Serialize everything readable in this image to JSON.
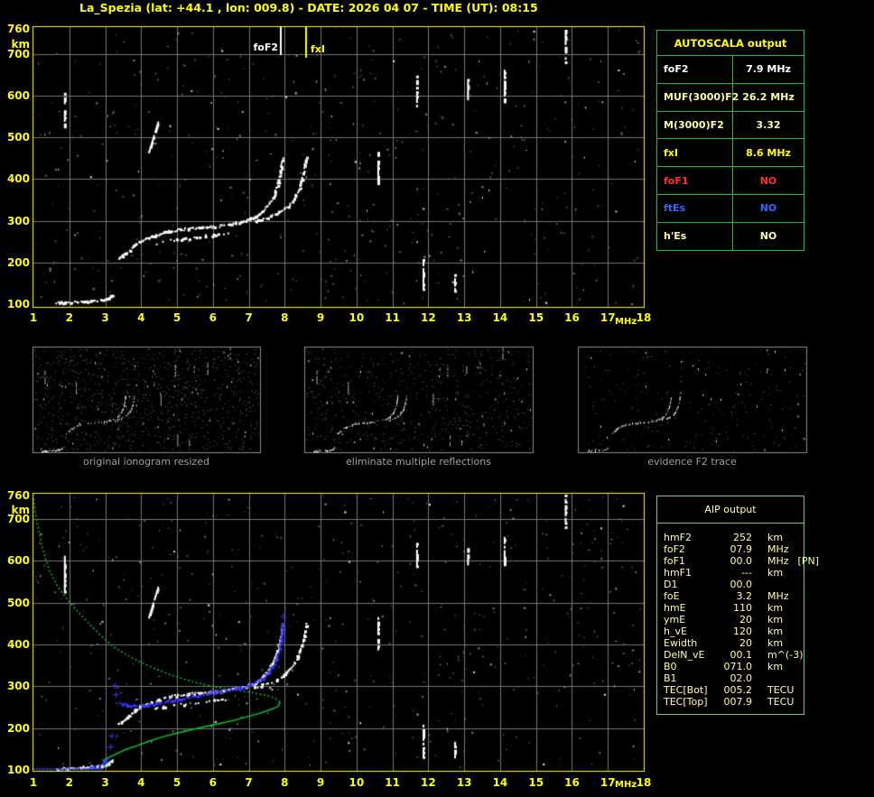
{
  "title": "La_Spezia (lat: +44.1 , lon: 009.8) - DATE:  2026 04 07  - TIME (UT):  08:15",
  "colors": {
    "accent_yellow": "#ffff00",
    "cream": "#ffff9e",
    "white": "#ffffff",
    "red": "#ff3232",
    "blue": "#3366ff",
    "profile_green": "#00cc33",
    "restored_blue": "#3333ff",
    "grid_gray": "#767676",
    "frame_yellow": "#ffff00",
    "autoscala_border": "#00c750",
    "aip_border": "#6fcf6f",
    "panel_border": "#8c8c8c",
    "caption_gray": "#a0a0a0"
  },
  "autoscala_table": {
    "header": "AUTOSCALA output",
    "rows": [
      {
        "label": "foF2",
        "value": "7.9 MHz",
        "color": "#ffffff"
      },
      {
        "label": "MUF(3000)F2",
        "value": "26.2 MHz",
        "color": "#ffff9e"
      },
      {
        "label": "M(3000)F2",
        "value": "3.32",
        "color": "#ffff9e"
      },
      {
        "label": "fxI",
        "value": "8.6 MHz",
        "color": "#ffff00"
      },
      {
        "label": "foF1",
        "value": "NO",
        "color": "#ff3232"
      },
      {
        "label": "ftEs",
        "value": "NO",
        "color": "#3366ff"
      },
      {
        "label": "h'Es",
        "value": "NO",
        "color": "#ffff9e"
      }
    ]
  },
  "aip_table": {
    "header": "AIP output",
    "rows": [
      {
        "label": "hmF2",
        "value": "252",
        "unit": "km",
        "note": ""
      },
      {
        "label": "foF2",
        "value": "07.9",
        "unit": "MHz",
        "note": ""
      },
      {
        "label": "foF1",
        "value": "00.0",
        "unit": "MHz",
        "note": "[PN]"
      },
      {
        "label": "hmF1",
        "value": "---",
        "unit": "km",
        "note": ""
      },
      {
        "label": "D1",
        "value": "00.0",
        "unit": "",
        "note": ""
      },
      {
        "label": "foE",
        "value": "3.2",
        "unit": "MHz",
        "note": ""
      },
      {
        "label": "hmE",
        "value": "110",
        "unit": "km",
        "note": ""
      },
      {
        "label": "ymE",
        "value": "20",
        "unit": "km",
        "note": ""
      },
      {
        "label": "h_vE",
        "value": "120",
        "unit": "km",
        "note": ""
      },
      {
        "label": "Ewidth",
        "value": "20",
        "unit": "km",
        "note": ""
      },
      {
        "label": "DelN_vE",
        "value": "00.1",
        "unit": "m^(-3)",
        "note": ""
      },
      {
        "label": "B0",
        "value": "071.0",
        "unit": "km",
        "note": ""
      },
      {
        "label": "B1",
        "value": "02.0",
        "unit": "",
        "note": ""
      },
      {
        "label": "TEC[Bot]",
        "value": "005.2",
        "unit": "TECU",
        "note": ""
      },
      {
        "label": "TEC[Top]",
        "value": "007.9",
        "unit": "TECU",
        "note": ""
      }
    ]
  },
  "panels": [
    {
      "caption": "original ionogram resized"
    },
    {
      "caption": "eliminate multiple reflections"
    },
    {
      "caption": "evidence F2 trace"
    }
  ],
  "chart_data": [
    {
      "type": "scatter",
      "name": "autoscaled ionogram",
      "xlabel": "MHz",
      "ylabel": "km",
      "xlim": [
        1,
        18
      ],
      "ylim": [
        100,
        760
      ],
      "xticks": [
        1,
        2,
        3,
        4,
        5,
        6,
        7,
        8,
        9,
        10,
        11,
        12,
        13,
        14,
        15,
        16,
        17,
        18
      ],
      "yticks": [
        760,
        700,
        600,
        500,
        400,
        300,
        200,
        100
      ],
      "grid": true,
      "markers": [
        {
          "label": "foF2",
          "freq": 7.9,
          "color": "#ffffff"
        },
        {
          "label": "fxI",
          "freq": 8.6,
          "color": "#ffff00"
        }
      ],
      "series": [
        {
          "name": "E-layer echo",
          "color": "#ffffff",
          "points": [
            [
              1.62,
              104
            ],
            [
              1.75,
              106
            ],
            [
              1.9,
              105
            ],
            [
              2.05,
              107
            ],
            [
              2.2,
              106
            ],
            [
              2.35,
              108
            ],
            [
              2.5,
              107
            ],
            [
              2.62,
              109
            ],
            [
              2.75,
              111
            ],
            [
              2.88,
              112
            ],
            [
              3.0,
              114
            ],
            [
              3.1,
              118
            ],
            [
              3.18,
              125
            ]
          ]
        },
        {
          "name": "F2 O-mode trace",
          "color": "#ffffff",
          "points": [
            [
              3.35,
              211
            ],
            [
              3.45,
              216
            ],
            [
              3.55,
              222
            ],
            [
              3.68,
              232
            ],
            [
              3.82,
              244
            ],
            [
              3.95,
              252
            ],
            [
              4.1,
              258
            ],
            [
              4.3,
              264
            ],
            [
              4.5,
              270
            ],
            [
              4.75,
              276
            ],
            [
              5.0,
              280
            ],
            [
              5.3,
              283
            ],
            [
              5.6,
              285
            ],
            [
              5.9,
              287
            ],
            [
              6.2,
              290
            ],
            [
              6.5,
              294
            ],
            [
              6.8,
              299
            ],
            [
              7.0,
              305
            ],
            [
              7.2,
              313
            ],
            [
              7.35,
              323
            ],
            [
              7.5,
              336
            ],
            [
              7.62,
              352
            ],
            [
              7.72,
              370
            ],
            [
              7.8,
              392
            ],
            [
              7.86,
              416
            ],
            [
              7.9,
              438
            ],
            [
              7.92,
              452
            ]
          ]
        },
        {
          "name": "F2 lower echo",
          "color": "#ffffff",
          "points": [
            [
              4.35,
              247
            ],
            [
              4.6,
              252
            ],
            [
              4.9,
              256
            ],
            [
              5.2,
              259
            ],
            [
              5.5,
              262
            ],
            [
              5.8,
              265
            ],
            [
              6.1,
              268
            ],
            [
              6.4,
              271
            ]
          ]
        },
        {
          "name": "F2 X-mode trace",
          "color": "#ffffff",
          "points": [
            [
              7.15,
              299
            ],
            [
              7.35,
              304
            ],
            [
              7.55,
              310
            ],
            [
              7.75,
              318
            ],
            [
              7.95,
              328
            ],
            [
              8.1,
              340
            ],
            [
              8.25,
              356
            ],
            [
              8.37,
              376
            ],
            [
              8.46,
              398
            ],
            [
              8.52,
              420
            ],
            [
              8.56,
              440
            ],
            [
              8.58,
              452
            ]
          ]
        }
      ],
      "interference_streaks": [
        [
          1.85,
          528,
          1.85,
          612
        ],
        [
          4.2,
          468,
          4.45,
          538
        ],
        [
          10.58,
          392,
          10.58,
          465
        ],
        [
          11.66,
          578,
          11.66,
          648
        ],
        [
          11.84,
          133,
          11.84,
          208
        ],
        [
          12.72,
          134,
          12.72,
          172
        ],
        [
          13.08,
          595,
          13.08,
          640
        ],
        [
          14.1,
          588,
          14.1,
          662
        ],
        [
          15.8,
          682,
          15.8,
          758
        ]
      ]
    },
    {
      "type": "scatter",
      "name": "ionogram with AIP inversion",
      "xlabel": "MHz",
      "ylabel": "km",
      "xlim": [
        1,
        18
      ],
      "ylim": [
        100,
        760
      ],
      "xticks": [
        1,
        2,
        3,
        4,
        5,
        6,
        7,
        8,
        9,
        10,
        11,
        12,
        13,
        14,
        15,
        16,
        17,
        18
      ],
      "yticks": [
        760,
        700,
        600,
        500,
        400,
        300,
        200,
        100
      ],
      "grid": true,
      "markers": [],
      "profile": {
        "name": "electron density profile",
        "color": "#00cc33",
        "topside": [
          [
            1.0,
            748
          ],
          [
            1.1,
            690
          ],
          [
            1.25,
            630
          ],
          [
            1.45,
            575
          ],
          [
            1.7,
            535
          ],
          [
            2.0,
            502
          ],
          [
            2.3,
            472
          ],
          [
            2.62,
            443
          ],
          [
            2.95,
            415
          ],
          [
            3.3,
            390
          ],
          [
            3.8,
            365
          ],
          [
            4.3,
            345
          ],
          [
            4.8,
            328
          ],
          [
            5.3,
            314
          ],
          [
            5.8,
            303
          ],
          [
            6.3,
            295
          ],
          [
            6.8,
            289
          ],
          [
            7.2,
            283
          ],
          [
            7.55,
            277
          ],
          [
            7.75,
            270
          ],
          [
            7.87,
            262
          ]
        ],
        "bottomside": [
          [
            7.87,
            262
          ],
          [
            7.82,
            252
          ],
          [
            7.6,
            244
          ],
          [
            7.3,
            235
          ],
          [
            7.0,
            228
          ],
          [
            6.6,
            219
          ],
          [
            6.2,
            211
          ],
          [
            5.8,
            204
          ],
          [
            5.4,
            196
          ],
          [
            5.0,
            188
          ],
          [
            4.6,
            179
          ],
          [
            4.2,
            168
          ],
          [
            3.85,
            157
          ],
          [
            3.55,
            148
          ],
          [
            3.3,
            138
          ],
          [
            3.1,
            130
          ],
          [
            2.95,
            123
          ],
          [
            2.97,
            118
          ],
          [
            3.08,
            115
          ],
          [
            3.1,
            110
          ],
          [
            2.98,
            106
          ],
          [
            2.8,
            104
          ],
          [
            2.55,
            103
          ],
          [
            2.35,
            103
          ]
        ]
      },
      "restored_trace": {
        "name": "restored trace",
        "color": "#3333ff",
        "points": [
          [
            3.32,
            263
          ],
          [
            3.45,
            259
          ],
          [
            3.6,
            257
          ],
          [
            3.8,
            256
          ],
          [
            4.0,
            256
          ],
          [
            4.2,
            258
          ],
          [
            4.45,
            261
          ],
          [
            4.7,
            265
          ],
          [
            5.0,
            270
          ],
          [
            5.3,
            275
          ],
          [
            5.6,
            280
          ],
          [
            5.9,
            285
          ],
          [
            6.2,
            289
          ],
          [
            6.5,
            294
          ],
          [
            6.75,
            298
          ],
          [
            7.0,
            304
          ],
          [
            7.2,
            312
          ],
          [
            7.4,
            323
          ],
          [
            7.55,
            337
          ],
          [
            7.68,
            354
          ],
          [
            7.78,
            376
          ],
          [
            7.85,
            400
          ],
          [
            7.9,
            426
          ],
          [
            7.93,
            452
          ]
        ],
        "plus_markers": [
          [
            3.14,
            156
          ],
          [
            3.17,
            182
          ],
          [
            3.26,
            302
          ],
          [
            3.29,
            281
          ],
          [
            7.9,
            412
          ],
          [
            7.93,
            440
          ],
          [
            7.95,
            468
          ]
        ],
        "baseline": {
          "height": 104,
          "from": 1.0,
          "to": 2.93
        },
        "baseline_rise": [
          [
            2.5,
            105
          ],
          [
            2.65,
            107
          ],
          [
            2.8,
            110
          ],
          [
            2.92,
            116
          ],
          [
            3.0,
            122
          ],
          [
            3.05,
            128
          ]
        ]
      }
    }
  ]
}
